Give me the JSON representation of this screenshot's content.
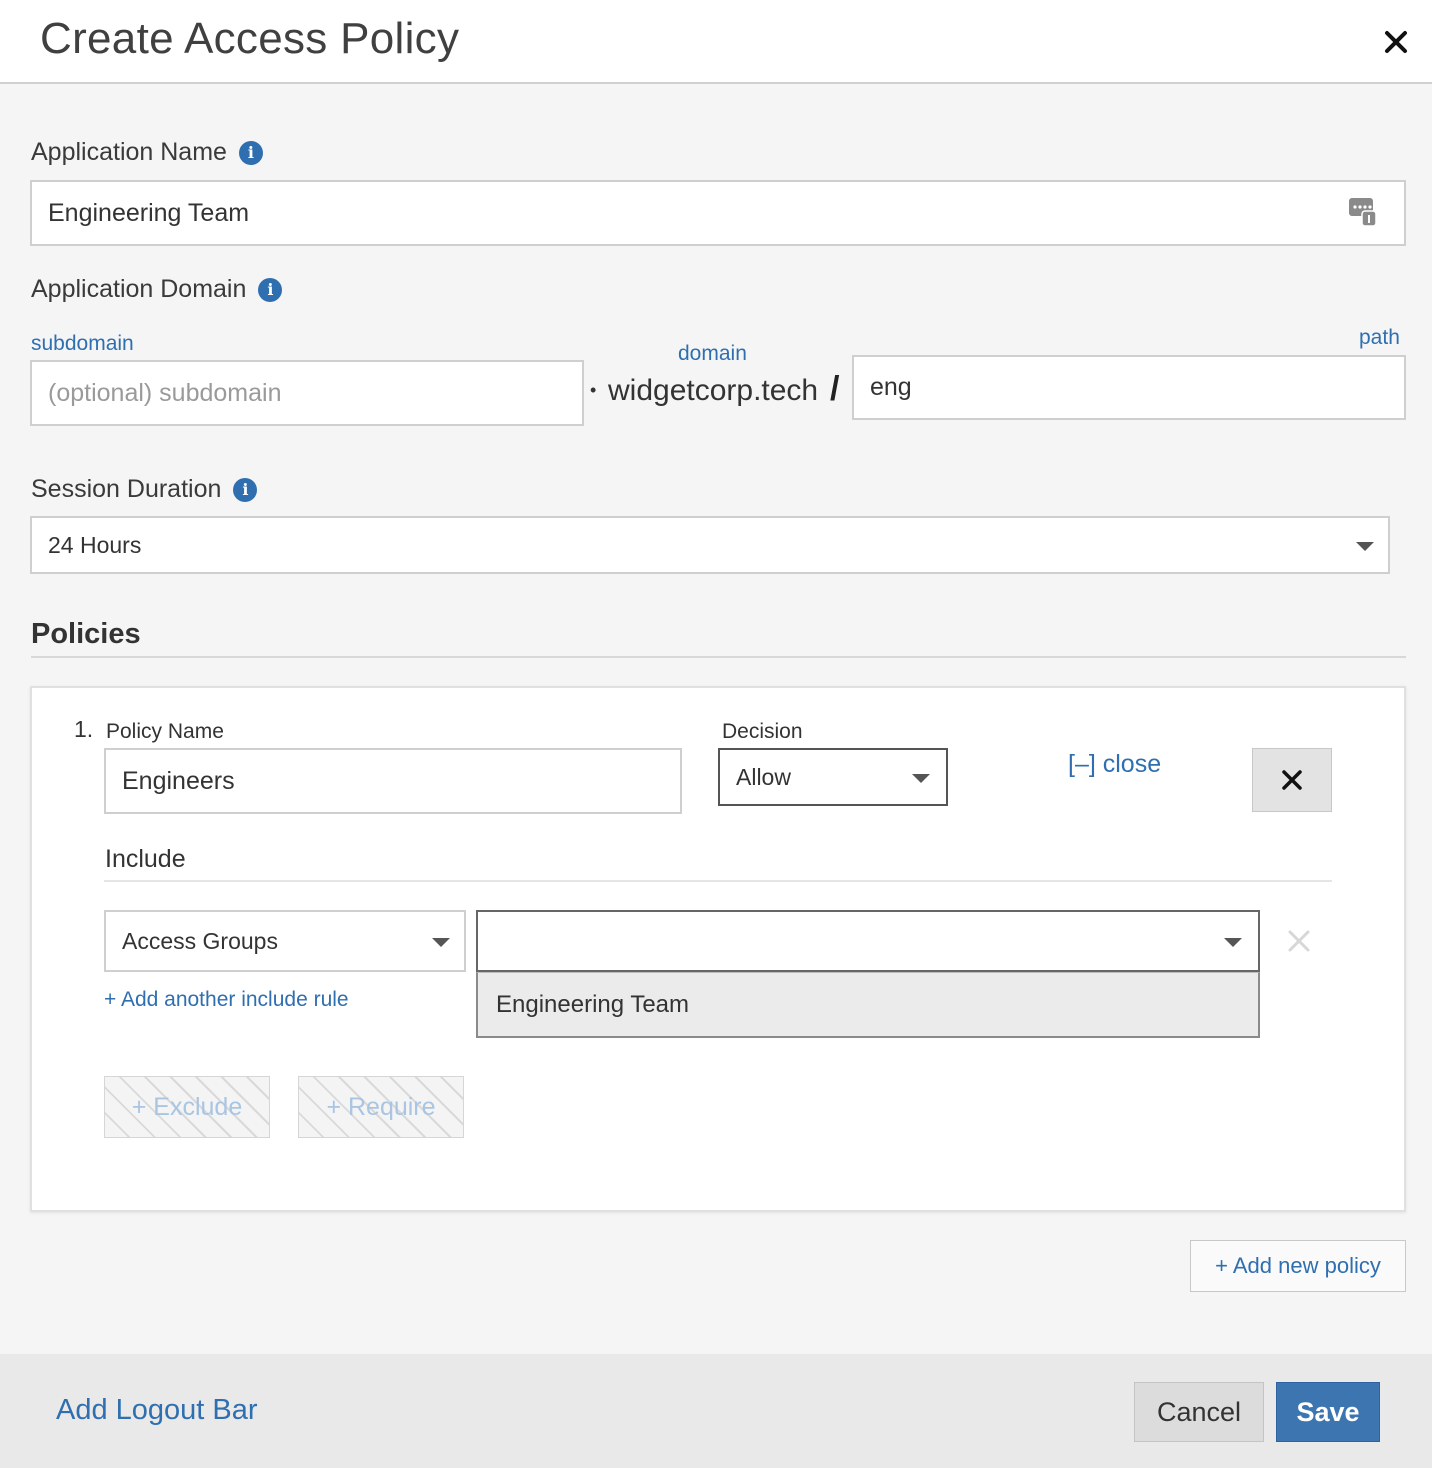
{
  "dialog": {
    "title": "Create Access Policy"
  },
  "app_name": {
    "label": "Application Name",
    "value": "Engineering Team"
  },
  "app_domain": {
    "label": "Application Domain",
    "subdomain_label": "subdomain",
    "subdomain_placeholder": "(optional) subdomain",
    "domain_label": "domain",
    "domain_value": "widgetcorp.tech",
    "dot": "•",
    "slash": "/",
    "path_label": "path",
    "path_value": "eng"
  },
  "session": {
    "label": "Session Duration",
    "value": "24 Hours"
  },
  "policies": {
    "title": "Policies",
    "items": [
      {
        "number": "1.",
        "name_label": "Policy Name",
        "name_value": "Engineers",
        "decision_label": "Decision",
        "decision_value": "Allow",
        "close_link": "[–] close",
        "include_label": "Include",
        "include_rule_type": "Access Groups",
        "include_rule_value": "",
        "dropdown_options": [
          "Engineering Team"
        ],
        "add_include_rule": "+ Add another include rule",
        "exclude_button": "+ Exclude",
        "require_button": "+ Require"
      }
    ],
    "add_policy_button": "+ Add new policy"
  },
  "footer": {
    "logout_bar_link": "Add Logout Bar",
    "cancel_button": "Cancel",
    "save_button": "Save"
  },
  "colors": {
    "accent": "#2f6fb0",
    "save_bg": "#3d75b0"
  },
  "icons": [
    "close-icon",
    "info-icon",
    "password-manager-icon",
    "chevron-down-icon",
    "remove-icon"
  ]
}
